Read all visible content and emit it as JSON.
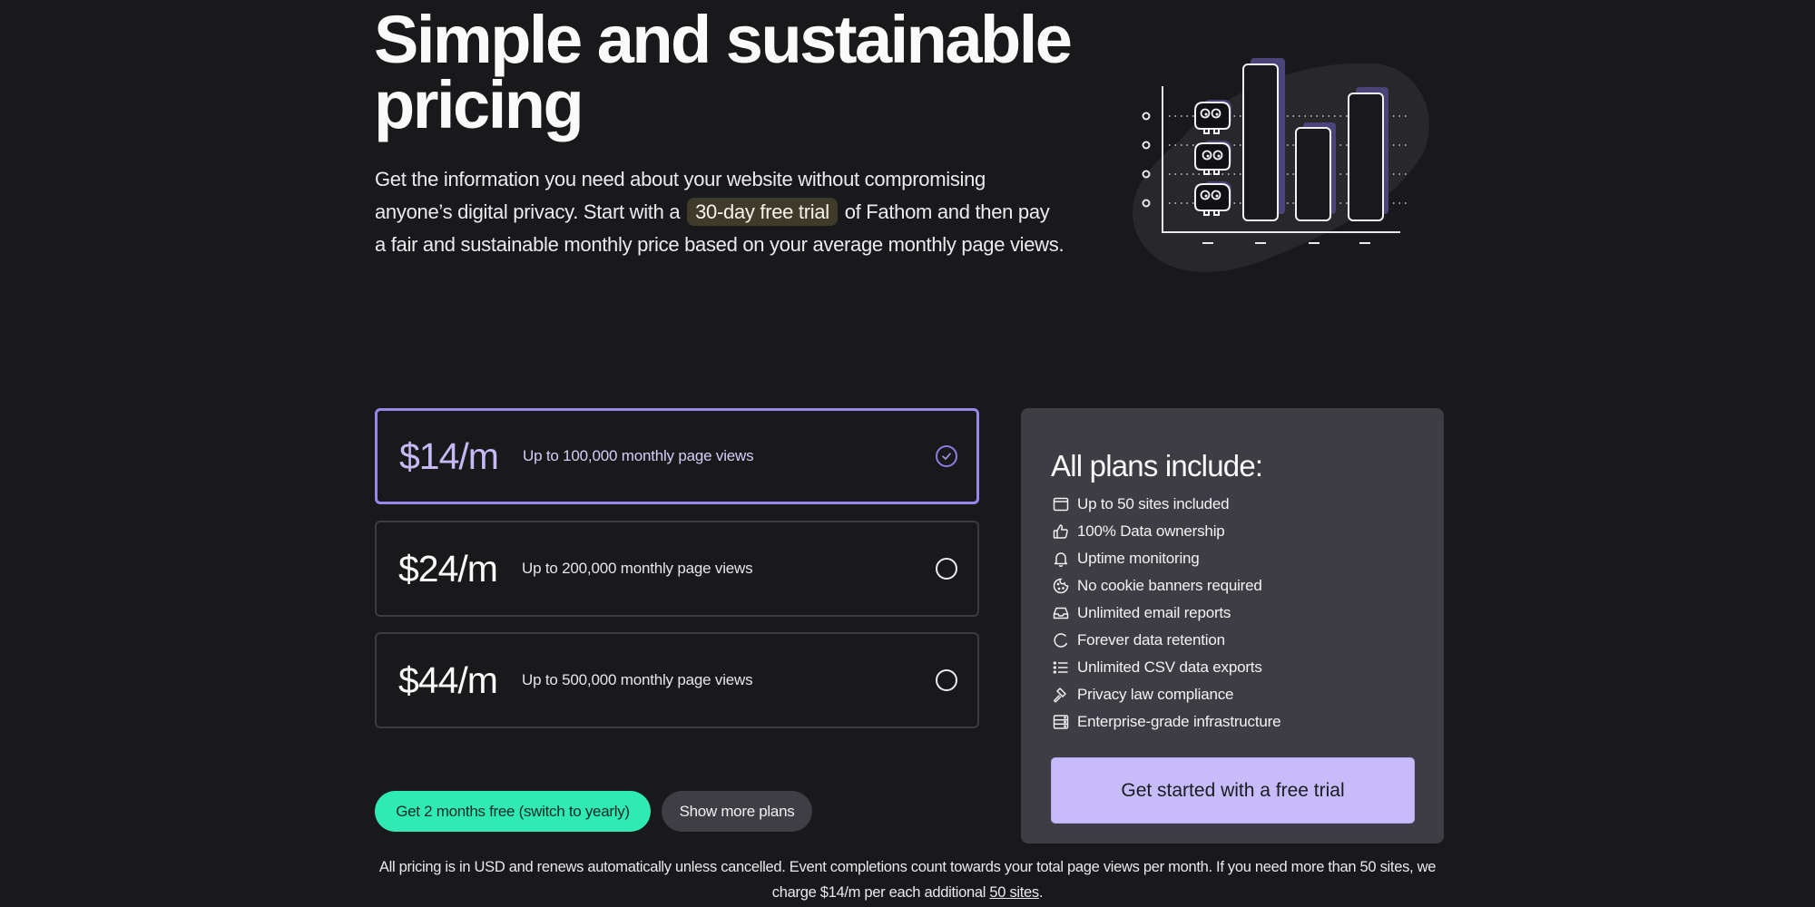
{
  "hero": {
    "title": "Simple and sustainable pricing",
    "description_before": "Get the information you need about your website without compromising anyone’s digital privacy. Start with a",
    "highlight": "30-day free trial",
    "description_after": "of Fathom and then pay a fair and sustainable monthly price based on your average monthly page views."
  },
  "illustration": {
    "semantic": "bar-chart-with-mascots",
    "accent_color": "#4b4478",
    "bar_heights_relative": [
      1.0,
      0.6,
      0.85
    ]
  },
  "plans": [
    {
      "price": "$14/m",
      "description": "Up to 100,000 monthly page views",
      "selected": true
    },
    {
      "price": "$24/m",
      "description": "Up to 200,000 monthly page views",
      "selected": false
    },
    {
      "price": "$44/m",
      "description": "Up to 500,000 monthly page views",
      "selected": false
    }
  ],
  "actions": {
    "yearly_label": "Get 2 months free (switch to yearly)",
    "more_plans_label": "Show more plans"
  },
  "includes": {
    "title": "All plans include:",
    "features": [
      {
        "icon": "browser-window-icon",
        "label": "Up to 50 sites included"
      },
      {
        "icon": "thumbs-up-icon",
        "label": "100% Data ownership"
      },
      {
        "icon": "bell-icon",
        "label": "Uptime monitoring"
      },
      {
        "icon": "cookie-icon",
        "label": "No cookie banners required"
      },
      {
        "icon": "inbox-icon",
        "label": "Unlimited email reports"
      },
      {
        "icon": "circle-icon",
        "label": "Forever data retention"
      },
      {
        "icon": "list-icon",
        "label": "Unlimited CSV data exports"
      },
      {
        "icon": "gavel-icon",
        "label": "Privacy law compliance"
      },
      {
        "icon": "server-icon",
        "label": "Enterprise-grade infrastructure"
      }
    ],
    "cta_label": "Get started with a free trial"
  },
  "footnote": {
    "text": "All pricing is in USD and renews automatically unless cancelled. Event completions count towards your total page views per month. If you need more than 50 sites, we charge $14/m per each additional",
    "link": "50 sites",
    "end": "."
  },
  "colors": {
    "background": "#19191b",
    "accent_purple": "#9a86ea",
    "cta_purple": "#c8bbfa",
    "green": "#30eab4",
    "panel": "#3d3d43"
  }
}
